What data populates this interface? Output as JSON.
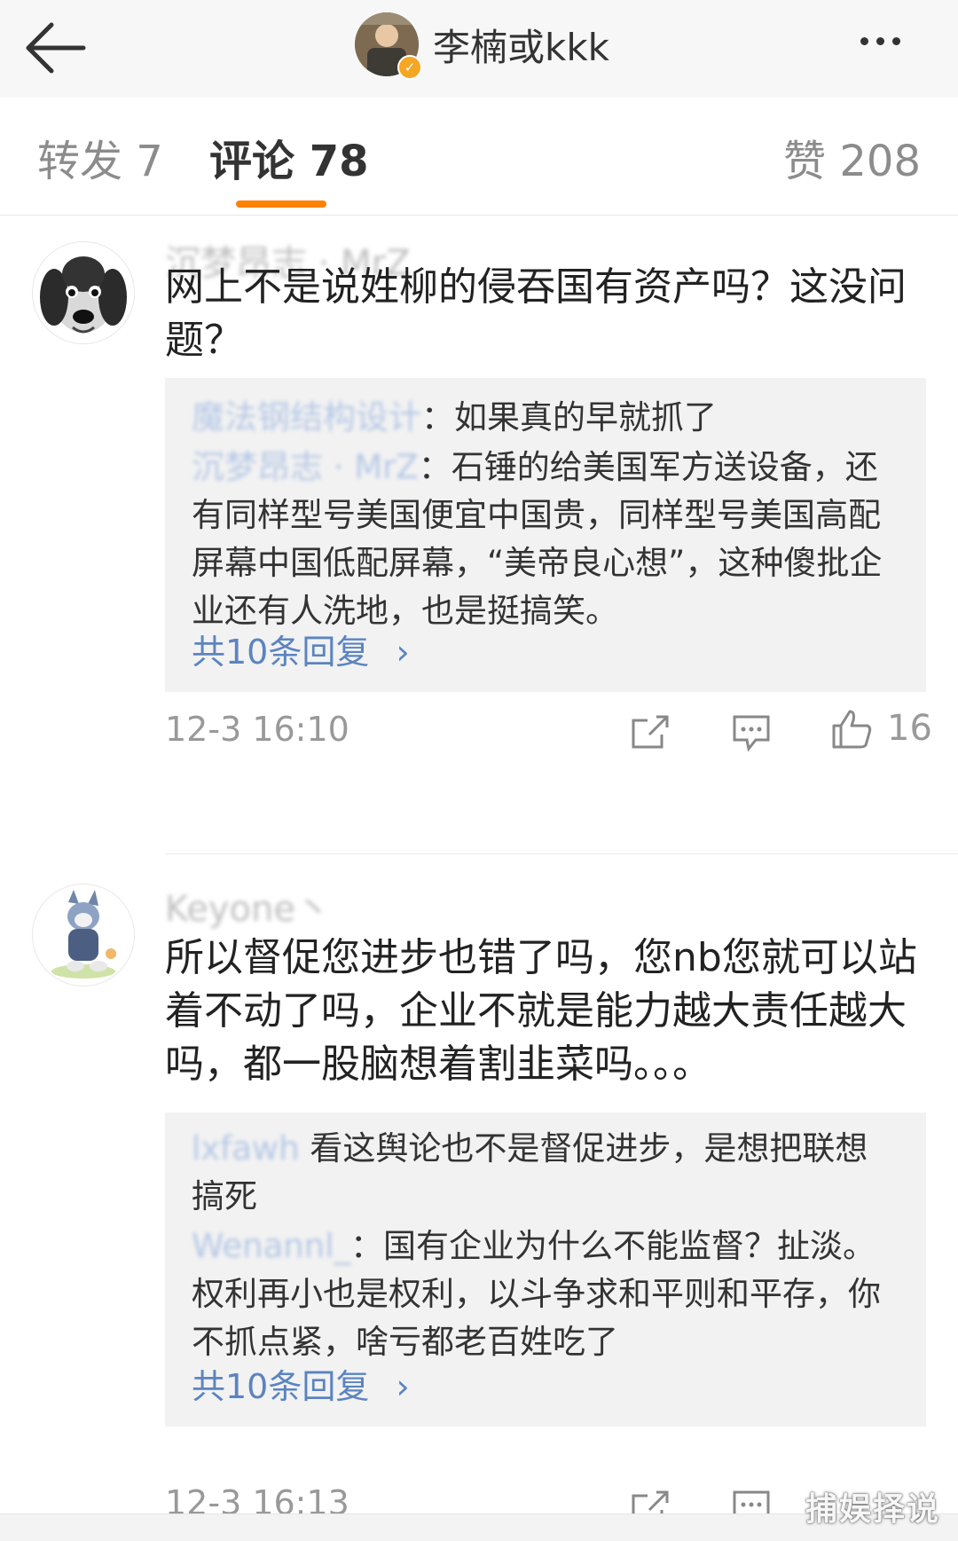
{
  "header": {
    "username": "李楠或kkk"
  },
  "tabs": {
    "repost": "转发 7",
    "comment": "评论 78",
    "like": "赞 208"
  },
  "comments": [
    {
      "username": "沉梦昂志 · MrZ",
      "text": "网上不是说姓柳的侵吞国有资产吗？这没问题？",
      "replies": [
        {
          "user": "魔法钢结构设计",
          "text": "：如果真的早就抓了"
        },
        {
          "user": "沉梦昂志 · MrZ",
          "text": "：石锤的给美国军方送设备，还有同样型号美国便宜中国贵，同样型号美国高配屏幕中国低配屏幕，“美帝良心想”，这种傻批企业还有人洗地，也是挺搞笑。"
        }
      ],
      "more_replies": "共10条回复",
      "time": "12-3 16:10",
      "likes": "16"
    },
    {
      "username": "Keyone丶",
      "text": "所以督促您进步也错了吗，您nb您就可以站着不动了吗，企业不就是能力越大责任越大吗，都一股脑想着割韭菜吗。。。",
      "replies": [
        {
          "user": "lxfawh",
          "text": " 看这舆论也不是督促进步，是想把联想搞死"
        },
        {
          "user": "Wenannl_",
          "text": "：国有企业为什么不能监督？扯淡。权利再小也是权利，以斗争求和平则和平存，你不抓点紧，啥亏都老百姓吃了"
        }
      ],
      "more_replies": "共10条回复",
      "time": "12-3 16:13",
      "likes": ""
    }
  ],
  "watermark": "捕娱择说",
  "colors": {
    "accent": "#ff8200",
    "link": "#5b84c0",
    "meta": "#999999"
  }
}
